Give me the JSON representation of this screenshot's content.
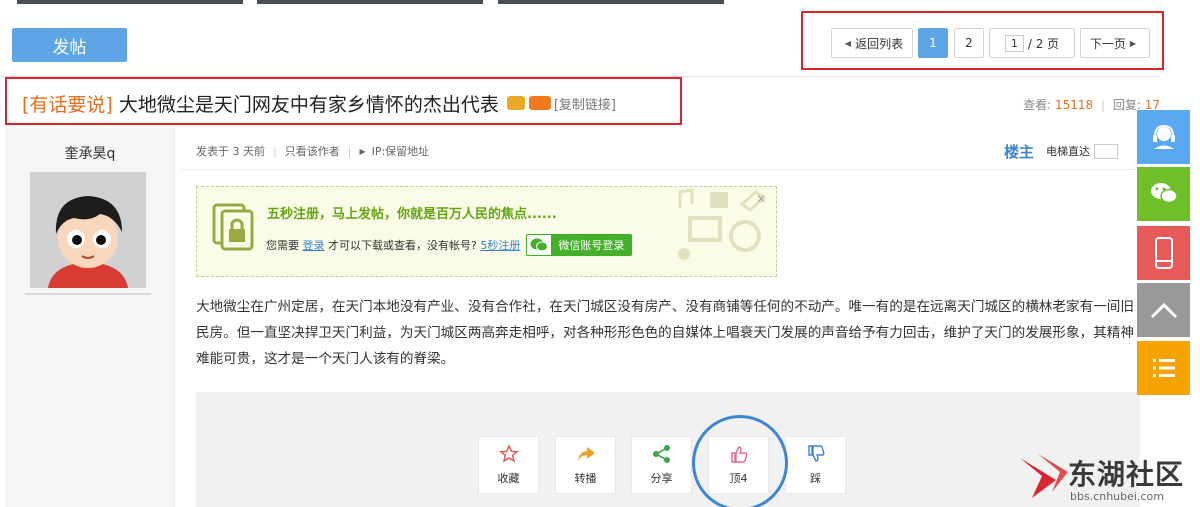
{
  "toolbar": {
    "post_label": "发帖"
  },
  "pager": {
    "back_label": "返回列表",
    "pages": [
      "1",
      "2"
    ],
    "current_page": "1",
    "total_label": "/ 2 页",
    "next_label": "下一页"
  },
  "thread": {
    "category": "[有话要说]",
    "title": "大地微尘是天门网友中有家乡情怀的杰出代表",
    "copy_link": "[复制链接]",
    "views_label": "查看:",
    "views": "15118",
    "replies_label": "回复:",
    "replies": "17"
  },
  "author": {
    "name": "奎承昊q"
  },
  "post_meta": {
    "posted": "发表于 3 天前",
    "only_author": "只看该作者",
    "ip": "IP:保留地址",
    "floor": "楼主",
    "elevator": "电梯直达"
  },
  "login_prompt": {
    "title": "五秒注册，马上发帖，你就是百万人民的焦点......",
    "text_before": "您需要",
    "login_link": "登录",
    "text_middle": "才可以下载或查看，没有帐号?",
    "register_link": "5秒注册",
    "wechat_label": "微信账号登录"
  },
  "post": {
    "content": "大地微尘在广州定居，在天门本地没有产业、没有合作社，在天门城区没有房产、没有商铺等任何的不动产。唯一有的是在远离天门城区的横林老家有一间旧民房。但一直坚决捍卫天门利益，为天门城区两高奔走相呼，对各种形形色色的自媒体上唱衰天门发展的声音给予有力回击，维护了天门的发展形象，其精神难能可贵，这才是一个天门人该有的脊梁。"
  },
  "actions": {
    "favorite": "收藏",
    "forward": "转播",
    "share": "分享",
    "like": "顶4",
    "dislike": "踩"
  },
  "float_bar": {
    "icons": [
      "customer-service-icon",
      "wechat-icon",
      "mobile-icon",
      "back-to-top-icon",
      "list-icon"
    ],
    "colors": [
      "#5aa9f0",
      "#6fbf2a",
      "#e85a5a",
      "#999999",
      "#f5a300"
    ]
  },
  "brand": {
    "name": "东湖社区",
    "url": "bbs.cnhubei.com"
  },
  "colors": {
    "accent_blue": "#5ea5e6",
    "highlight_red": "#d8262c",
    "category_orange": "#e96d1d",
    "login_green": "#63a414"
  }
}
